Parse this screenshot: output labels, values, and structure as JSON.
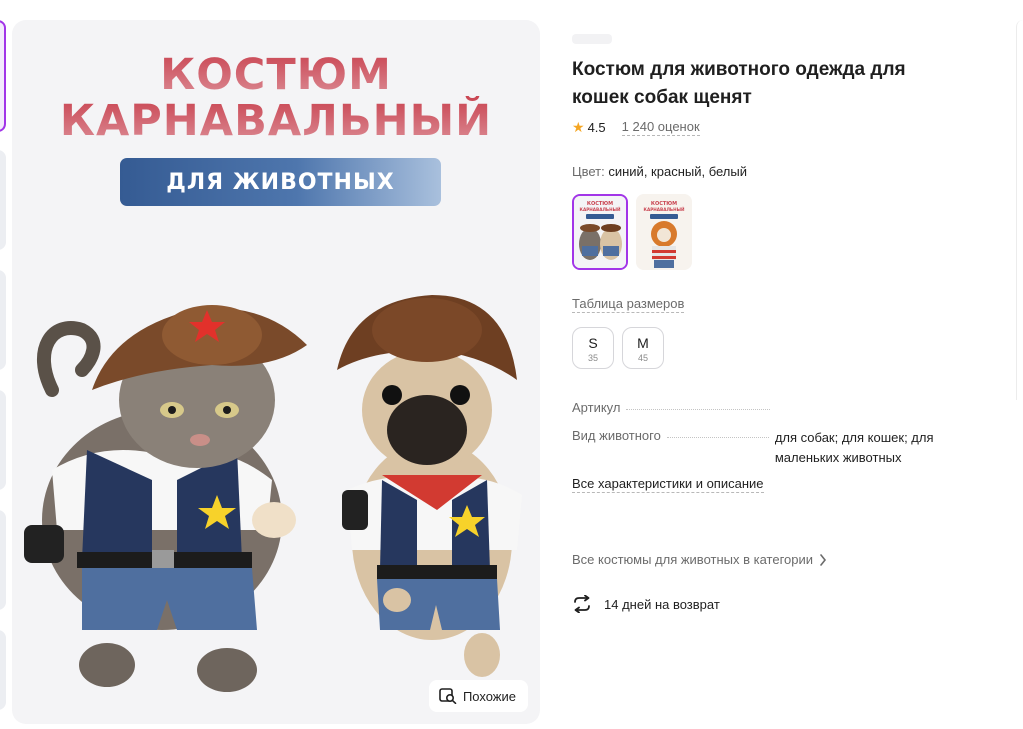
{
  "product": {
    "title": "Костюм для животного одежда для кошек собак щенят",
    "rating": "4.5",
    "reviews": "1 240 оценок",
    "color_label": "Цвет: ",
    "color_value": "синий, красный, белый"
  },
  "image": {
    "banner_line1": "КОСТЮМ",
    "banner_line2": "КАРНАВАЛЬНЫЙ",
    "banner_pill": "ДЛЯ ЖИВОТНЫХ",
    "similar_label": "Похожие",
    "swatch_line1": "КОСТЮМ",
    "swatch_line2": "КАРНАВАЛЬНЫЙ"
  },
  "sizes": {
    "table_link": "Таблица размеров",
    "options": [
      {
        "size": "S",
        "sub": "35"
      },
      {
        "size": "M",
        "sub": "45"
      }
    ]
  },
  "attributes": [
    {
      "name": "Артикул",
      "value": ""
    },
    {
      "name": "Вид животного",
      "value": "для собак; для кошек; для маленьких животных"
    }
  ],
  "links": {
    "all_characteristics": "Все характеристики и описание",
    "category": "Все костюмы для животных в категории",
    "return_policy": "14 дней на возврат"
  },
  "colors": {
    "accent": "#a235e8",
    "banner_red": "#c94451",
    "banner_blue": "#355b93",
    "star": "#f5a623"
  },
  "icons": [
    "star-icon",
    "chevron-right-icon",
    "return-arrows-icon",
    "image-search-icon"
  ]
}
